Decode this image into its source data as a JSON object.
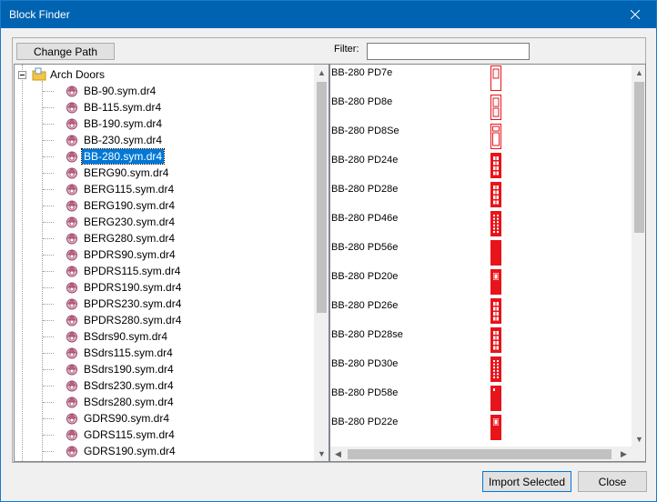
{
  "window": {
    "title": "Block Finder"
  },
  "toolbar": {
    "change_path_label": "Change Path",
    "filter_label": "Filter:",
    "filter_value": ""
  },
  "tree": {
    "root_label": "Arch Doors",
    "items": [
      "BB-90.sym.dr4",
      "BB-115.sym.dr4",
      "BB-190.sym.dr4",
      "BB-230.sym.dr4",
      "BB-280.sym.dr4",
      "BERG90.sym.dr4",
      "BERG115.sym.dr4",
      "BERG190.sym.dr4",
      "BERG230.sym.dr4",
      "BERG280.sym.dr4",
      "BPDRS90.sym.dr4",
      "BPDRS115.sym.dr4",
      "BPDRS190.sym.dr4",
      "BPDRS230.sym.dr4",
      "BPDRS280.sym.dr4",
      "BSdrs90.sym.dr4",
      "BSdrs115.sym.dr4",
      "BSdrs190.sym.dr4",
      "BSdrs230.sym.dr4",
      "BSdrs280.sym.dr4",
      "GDRS90.sym.dr4",
      "GDRS115.sym.dr4",
      "GDRS190.sym.dr4"
    ],
    "selected": "BB-280.sym.dr4"
  },
  "blocks": [
    {
      "name": "BB-280 PD7e",
      "style": "upper-panel"
    },
    {
      "name": "BB-280 PD8e",
      "style": "two-panel"
    },
    {
      "name": "BB-280 PD8Se",
      "style": "two-panel-wide"
    },
    {
      "name": "BB-280 PD24e",
      "style": "panels-grid"
    },
    {
      "name": "BB-280 PD28e",
      "style": "panels-grid"
    },
    {
      "name": "BB-280 PD46e",
      "style": "glass-grid"
    },
    {
      "name": "BB-280 PD56e",
      "style": "solid"
    },
    {
      "name": "BB-280 PD20e",
      "style": "window-top"
    },
    {
      "name": "BB-280 PD26e",
      "style": "panels-grid"
    },
    {
      "name": "BB-280 PD28se",
      "style": "panels-grid"
    },
    {
      "name": "BB-280 PD30e",
      "style": "glass-grid"
    },
    {
      "name": "BB-280 PD58e",
      "style": "solid-slot"
    },
    {
      "name": "BB-280 PD22e",
      "style": "window-top"
    }
  ],
  "buttons": {
    "import_label": "Import Selected",
    "close_label": "Close"
  },
  "colors": {
    "titlebar": "#0063b1",
    "selection": "#0078d7",
    "block_red": "#e8141b"
  }
}
